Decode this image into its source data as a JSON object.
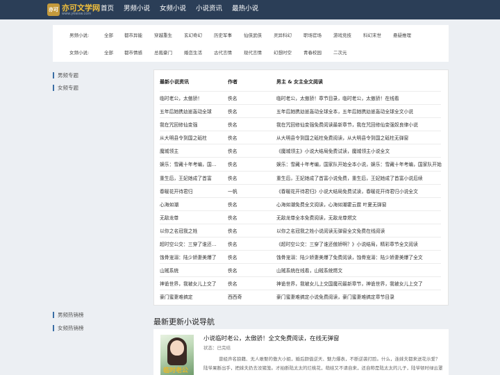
{
  "header": {
    "logo_badge": "亦可",
    "logo_name": "亦可文学网",
    "logo_url": "www.ykwxw.com",
    "nav": [
      "首页",
      "男频小说",
      "女频小说",
      "小说资讯",
      "最热小说"
    ]
  },
  "filters": {
    "male_label": "男频小说:",
    "male": [
      "全部",
      "都市异能",
      "穿越重生",
      "玄幻奇幻",
      "历史军事",
      "仙侠武侠",
      "灵异科幻",
      "职场官场",
      "游戏竞技",
      "科幻末世",
      "悬疑推理"
    ],
    "female_label": "女频小说:",
    "female": [
      "全部",
      "都市情感",
      "总裁豪门",
      "婚恋生活",
      "古代言情",
      "现代言情",
      "幻想时空",
      "青春校园",
      "二次元"
    ]
  },
  "sidebar": {
    "topics": [
      "男频专题",
      "女频专题"
    ],
    "hot": [
      "男频热销榜",
      "女频热销榜"
    ]
  },
  "table": {
    "headers": [
      "最新小说资讯",
      "作者",
      "男主 & 女主全文阅读"
    ],
    "rows": [
      [
        "临时老公，太傲骄！",
        "佚名",
        "临时老公，太傲骄！章节目录，临时老公，太傲骄！在线看"
      ],
      [
        "五年后她携幼崽轰动全球",
        "佚名",
        "五年后她携幼崽轰动全球全本，五年后她携幼崽轰动全球全文小说"
      ],
      [
        "我在咒回修仙变强",
        "佚名",
        "我在咒回修仙变强免费阅读最新章节，我在咒回修仙变强奴良律小说"
      ],
      [
        "从大明县令到国之砥柱",
        "佚名",
        "从大明县令到国之砥柱免费阅读，从大明县令到国之砥柱无弹窗"
      ],
      [
        "魔城领主",
        "佚名",
        "《魔城领主》小说大结局免费试读，魔城领主小说全文"
      ],
      [
        "娱乐：雪藏十年考编，国家队",
        "佚名",
        "娱乐：雪藏十年考编，国家队开始全本小说，娱乐：雪藏十年考编，国家队开始"
      ],
      [
        "重生后，王妃她成了首富",
        "佚名",
        "重生后，王妃她成了首富小说免费，重生后，王妃她成了首富小说后续"
      ],
      [
        "春暖花开待君归",
        "一帆",
        "《春暖花开待君归》小说大结局免费试读，春暖花开待君归小说全文"
      ],
      [
        "心海如潮",
        "佚名",
        "心海如潮免费全文阅读，心海如潮霍云霆 叶夏无弹窗"
      ],
      [
        "无敌龙尊",
        "佚名",
        "无敌龙尊全本免费阅读，无敌龙尊燃文"
      ],
      [
        "以你之名冠我之姓",
        "佚名",
        "以你之名冠我之姓小说阅读无弹窗全文免费在线阅读"
      ],
      [
        "超时空公交：三穿了谁还傲娇",
        "佚名",
        "《超时空公交：三穿了谁还傲娇啊？》小说结局，精彩章节全文阅读"
      ],
      [
        "蚀骨宠溺：陆少娇妻美爆了",
        "佚名",
        "蚀骨宠溺：陆少娇妻美爆了免费阅读，蚀骨宠溺：陆少娇妻美爆了全文"
      ],
      [
        "山贼系统",
        "佚名",
        "山贼系统在线看，山贼系统燃文"
      ],
      [
        "神诡世界，我被女儿上交了",
        "佚名",
        "神诡世界，我被女儿上交国魔司最新章节，神诡世界，我被女儿上交了"
      ],
      [
        "豪门蜜妻难搞定",
        "西西奇",
        "豪门蜜妻难搞定小说免费阅读，豪门蜜妻难搞定章节目录"
      ]
    ]
  },
  "latest": {
    "section_title": "最新更新小说导航",
    "title": "小说临时老公，太傲骄！全文免费阅读，在线无弹窗",
    "status": "状态：已完结",
    "desc": "曾经声名狼藉、无人敢娶的傲大小姐，婚后颜值逆天、魅力爆表，不断逆袭打脸。什么，连妹夫都来送花示爱？陆爷果断出手，把妹夫扔去没猪笼。才拍断陆太太的烂桃花，萌娃又不请自来，还自称是陆太太的儿子，陆爷顿时绿云罩顶。",
    "cover_text": "临时老公"
  }
}
